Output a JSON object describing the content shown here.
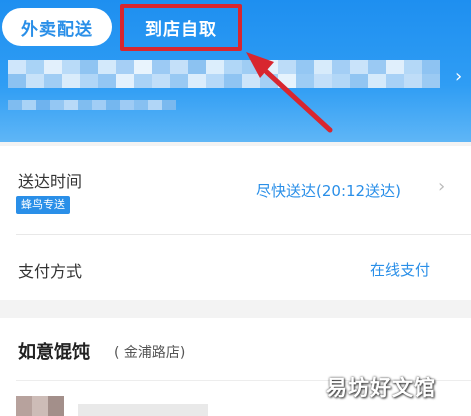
{
  "tabs": {
    "delivery_label": "外卖配送",
    "pickup_label": "到店自取"
  },
  "delivery_time": {
    "label": "送达时间",
    "badge": "蜂鸟专送",
    "value": "尽快送达(20:12送达)"
  },
  "payment": {
    "label": "支付方式",
    "value": "在线支付"
  },
  "shop": {
    "name": "如意馄饨",
    "branch": "( 金浦路店)"
  },
  "watermark": "易坊好文馆",
  "colors": {
    "header_blue": "#1e8ff0",
    "accent_blue": "#2a8fe8",
    "highlight_red": "#d8262f"
  },
  "icons": {
    "chevron": "chevron-right-icon",
    "arrow": "red-pointer-arrow"
  }
}
